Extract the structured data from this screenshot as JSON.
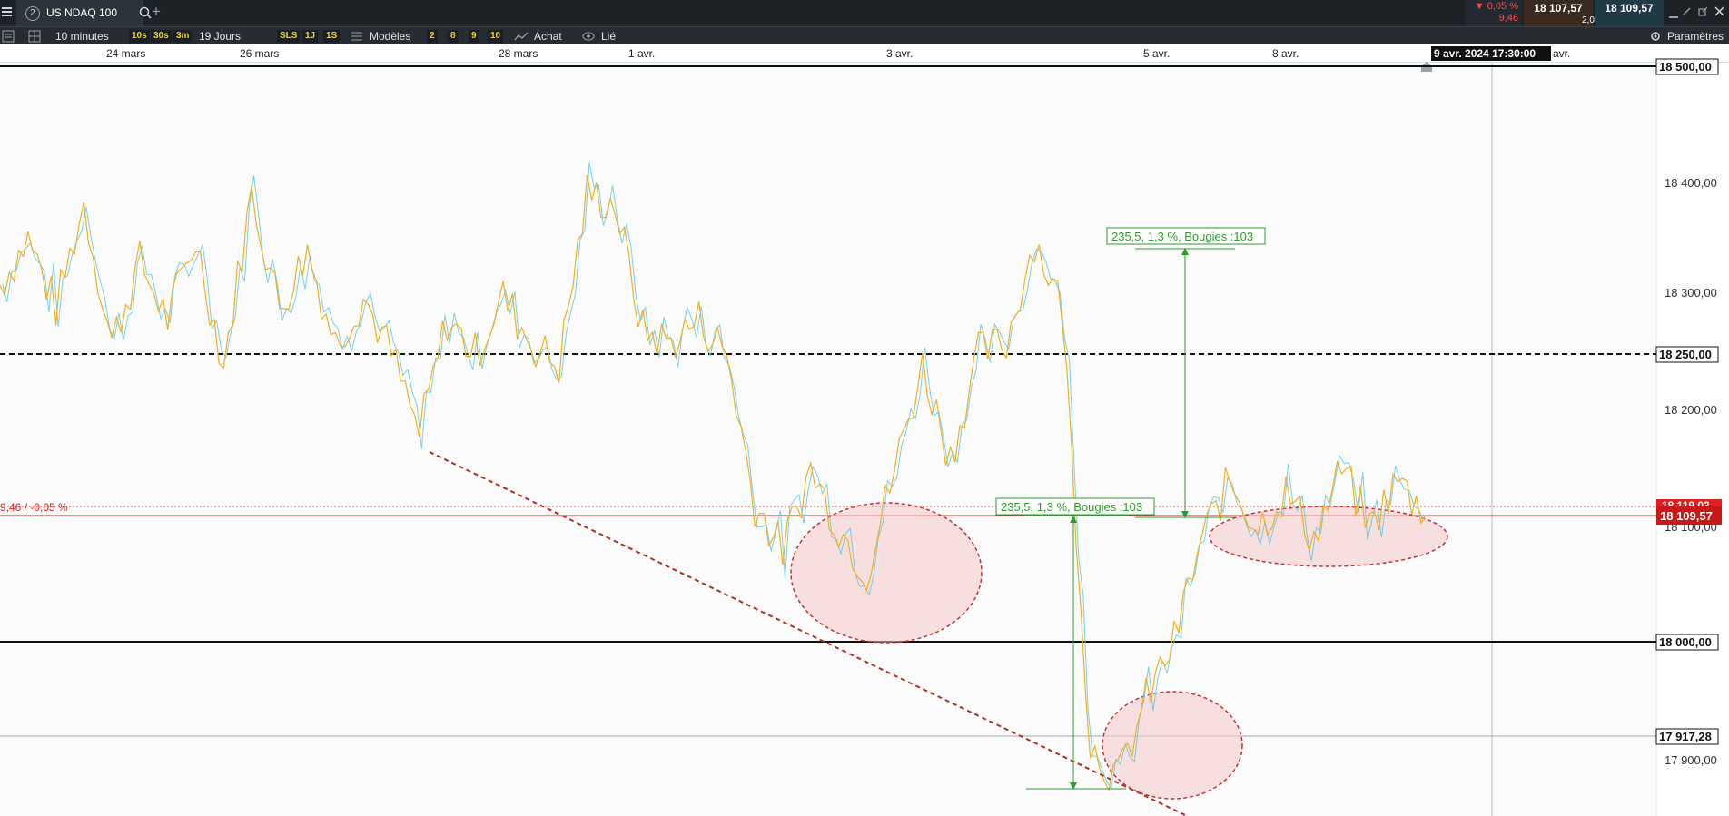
{
  "header": {
    "tab_number": "2",
    "instrument": "US NDAQ 100",
    "add_tab": "+",
    "change_pct": "▼ 0,05 %",
    "change_pts": "9,46",
    "bid": "18 107,57",
    "spread": "2,00",
    "ask": "18 109,57"
  },
  "toolbar": {
    "interval": "10 minutes",
    "quick_intervals": [
      "10s",
      "30s",
      "3m"
    ],
    "period": "19 Jours",
    "quick_periods": [
      "SLS",
      "1J",
      "1S"
    ],
    "models_label": "Modèles",
    "model_presets": [
      "2",
      "8",
      "9",
      "10"
    ],
    "buy_label": "Achat",
    "linked_label": "Lié",
    "settings_label": "Paramètres"
  },
  "colors": {
    "bg_dark": "#1d2226",
    "accent_yellow": "#f2d21b",
    "sell_red": "#ff4d4d",
    "price_line_red": "#e02020",
    "annotation_green": "#2e9a2e",
    "ellipse_fill": "#f6c9c9",
    "ellipse_stroke": "#c83030",
    "series_a": "#f0b020",
    "series_b": "#5fc8e6"
  },
  "chart": {
    "date_labels": [
      "24 mars",
      "26 mars",
      "28 mars",
      "1 avr.",
      "3 avr.",
      "5 avr.",
      "8 avr.",
      "avr."
    ],
    "cursor_date": "9 avr. 2024 17:30:00",
    "price_ticks": [
      "18 400,00",
      "18 300,00",
      "18 200,00",
      "18 100,00",
      "17 900,00"
    ],
    "horizontal_levels": {
      "top": "18 500,00",
      "dashed": "18 250,00",
      "solid": "18 000,00",
      "grey": "17 917,28"
    },
    "last_price": "18 109,57",
    "prev_price_hidden": "18 119,03",
    "change_line_label": "9,46 / -0,05 %",
    "measure_upper": "235,5, 1,3 %, Bougies :103",
    "measure_lower": "235,5, 1,3 %, Bougies :103"
  },
  "chart_data": {
    "type": "line",
    "ylim": [
      17850,
      18500
    ],
    "x_range": [
      "23 mars",
      "9 avr. 2024"
    ],
    "series": [
      {
        "values": [
          18310,
          18350,
          18290,
          18380,
          18260,
          18330,
          18280,
          18350,
          18240,
          18390,
          18290,
          18340,
          18260,
          18300,
          18250,
          18180,
          18280,
          18250,
          18300,
          18260,
          18240,
          18390,
          18380,
          18270,
          18260,
          18280,
          18250,
          18120,
          18080,
          18150,
          18100,
          18060,
          18150,
          18240,
          18160,
          18250,
          18260,
          18350,
          18290,
          17910,
          17880,
          17950,
          18000,
          18090,
          18140,
          18100,
          18130,
          18090,
          18150,
          18100,
          18140,
          18110
        ]
      }
    ]
  }
}
